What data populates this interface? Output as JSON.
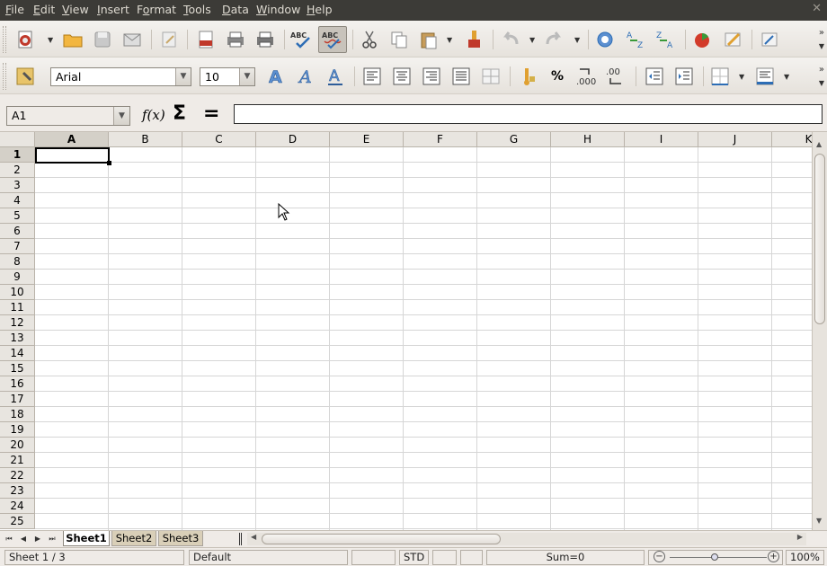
{
  "menubar": {
    "items": [
      {
        "pre": "",
        "u": "F",
        "post": "ile"
      },
      {
        "pre": "",
        "u": "E",
        "post": "dit"
      },
      {
        "pre": "",
        "u": "V",
        "post": "iew"
      },
      {
        "pre": "",
        "u": "I",
        "post": "nsert"
      },
      {
        "pre": "F",
        "u": "o",
        "post": "rmat"
      },
      {
        "pre": "",
        "u": "T",
        "post": "ools"
      },
      {
        "pre": "",
        "u": "D",
        "post": "ata"
      },
      {
        "pre": "",
        "u": "W",
        "post": "indow"
      },
      {
        "pre": "",
        "u": "H",
        "post": "elp"
      }
    ],
    "close_glyph": "✕"
  },
  "formatting": {
    "font_name": "Arial",
    "font_size": "10",
    "percent_glyph": "%",
    "decimal_add": ".000",
    "spell_label": "ABC"
  },
  "formula_bar": {
    "name_box": "A1",
    "fx_label": "f(x)",
    "sum_glyph": "Σ",
    "equals_glyph": "=",
    "content": ""
  },
  "grid": {
    "columns": [
      "A",
      "B",
      "C",
      "D",
      "E",
      "F",
      "G",
      "H",
      "I",
      "J",
      "K"
    ],
    "rows": [
      "1",
      "2",
      "3",
      "4",
      "5",
      "6",
      "7",
      "8",
      "9",
      "10",
      "11",
      "12",
      "13",
      "14",
      "15",
      "16",
      "17",
      "18",
      "19",
      "20",
      "21",
      "22",
      "23",
      "24",
      "25"
    ],
    "selected_cell": "A1"
  },
  "sheets": {
    "tabs": [
      "Sheet1",
      "Sheet2",
      "Sheet3"
    ],
    "active": "Sheet1"
  },
  "statusbar": {
    "sheet_position": "Sheet 1 / 3",
    "page_style": "Default",
    "selection_mode": "STD",
    "sum": "Sum=0",
    "zoom": "100%"
  },
  "colors": {
    "menubar_bg": "#3c3b37",
    "accent_blue": "#2d6db5",
    "inactive_tab": "#d9cfb8"
  }
}
